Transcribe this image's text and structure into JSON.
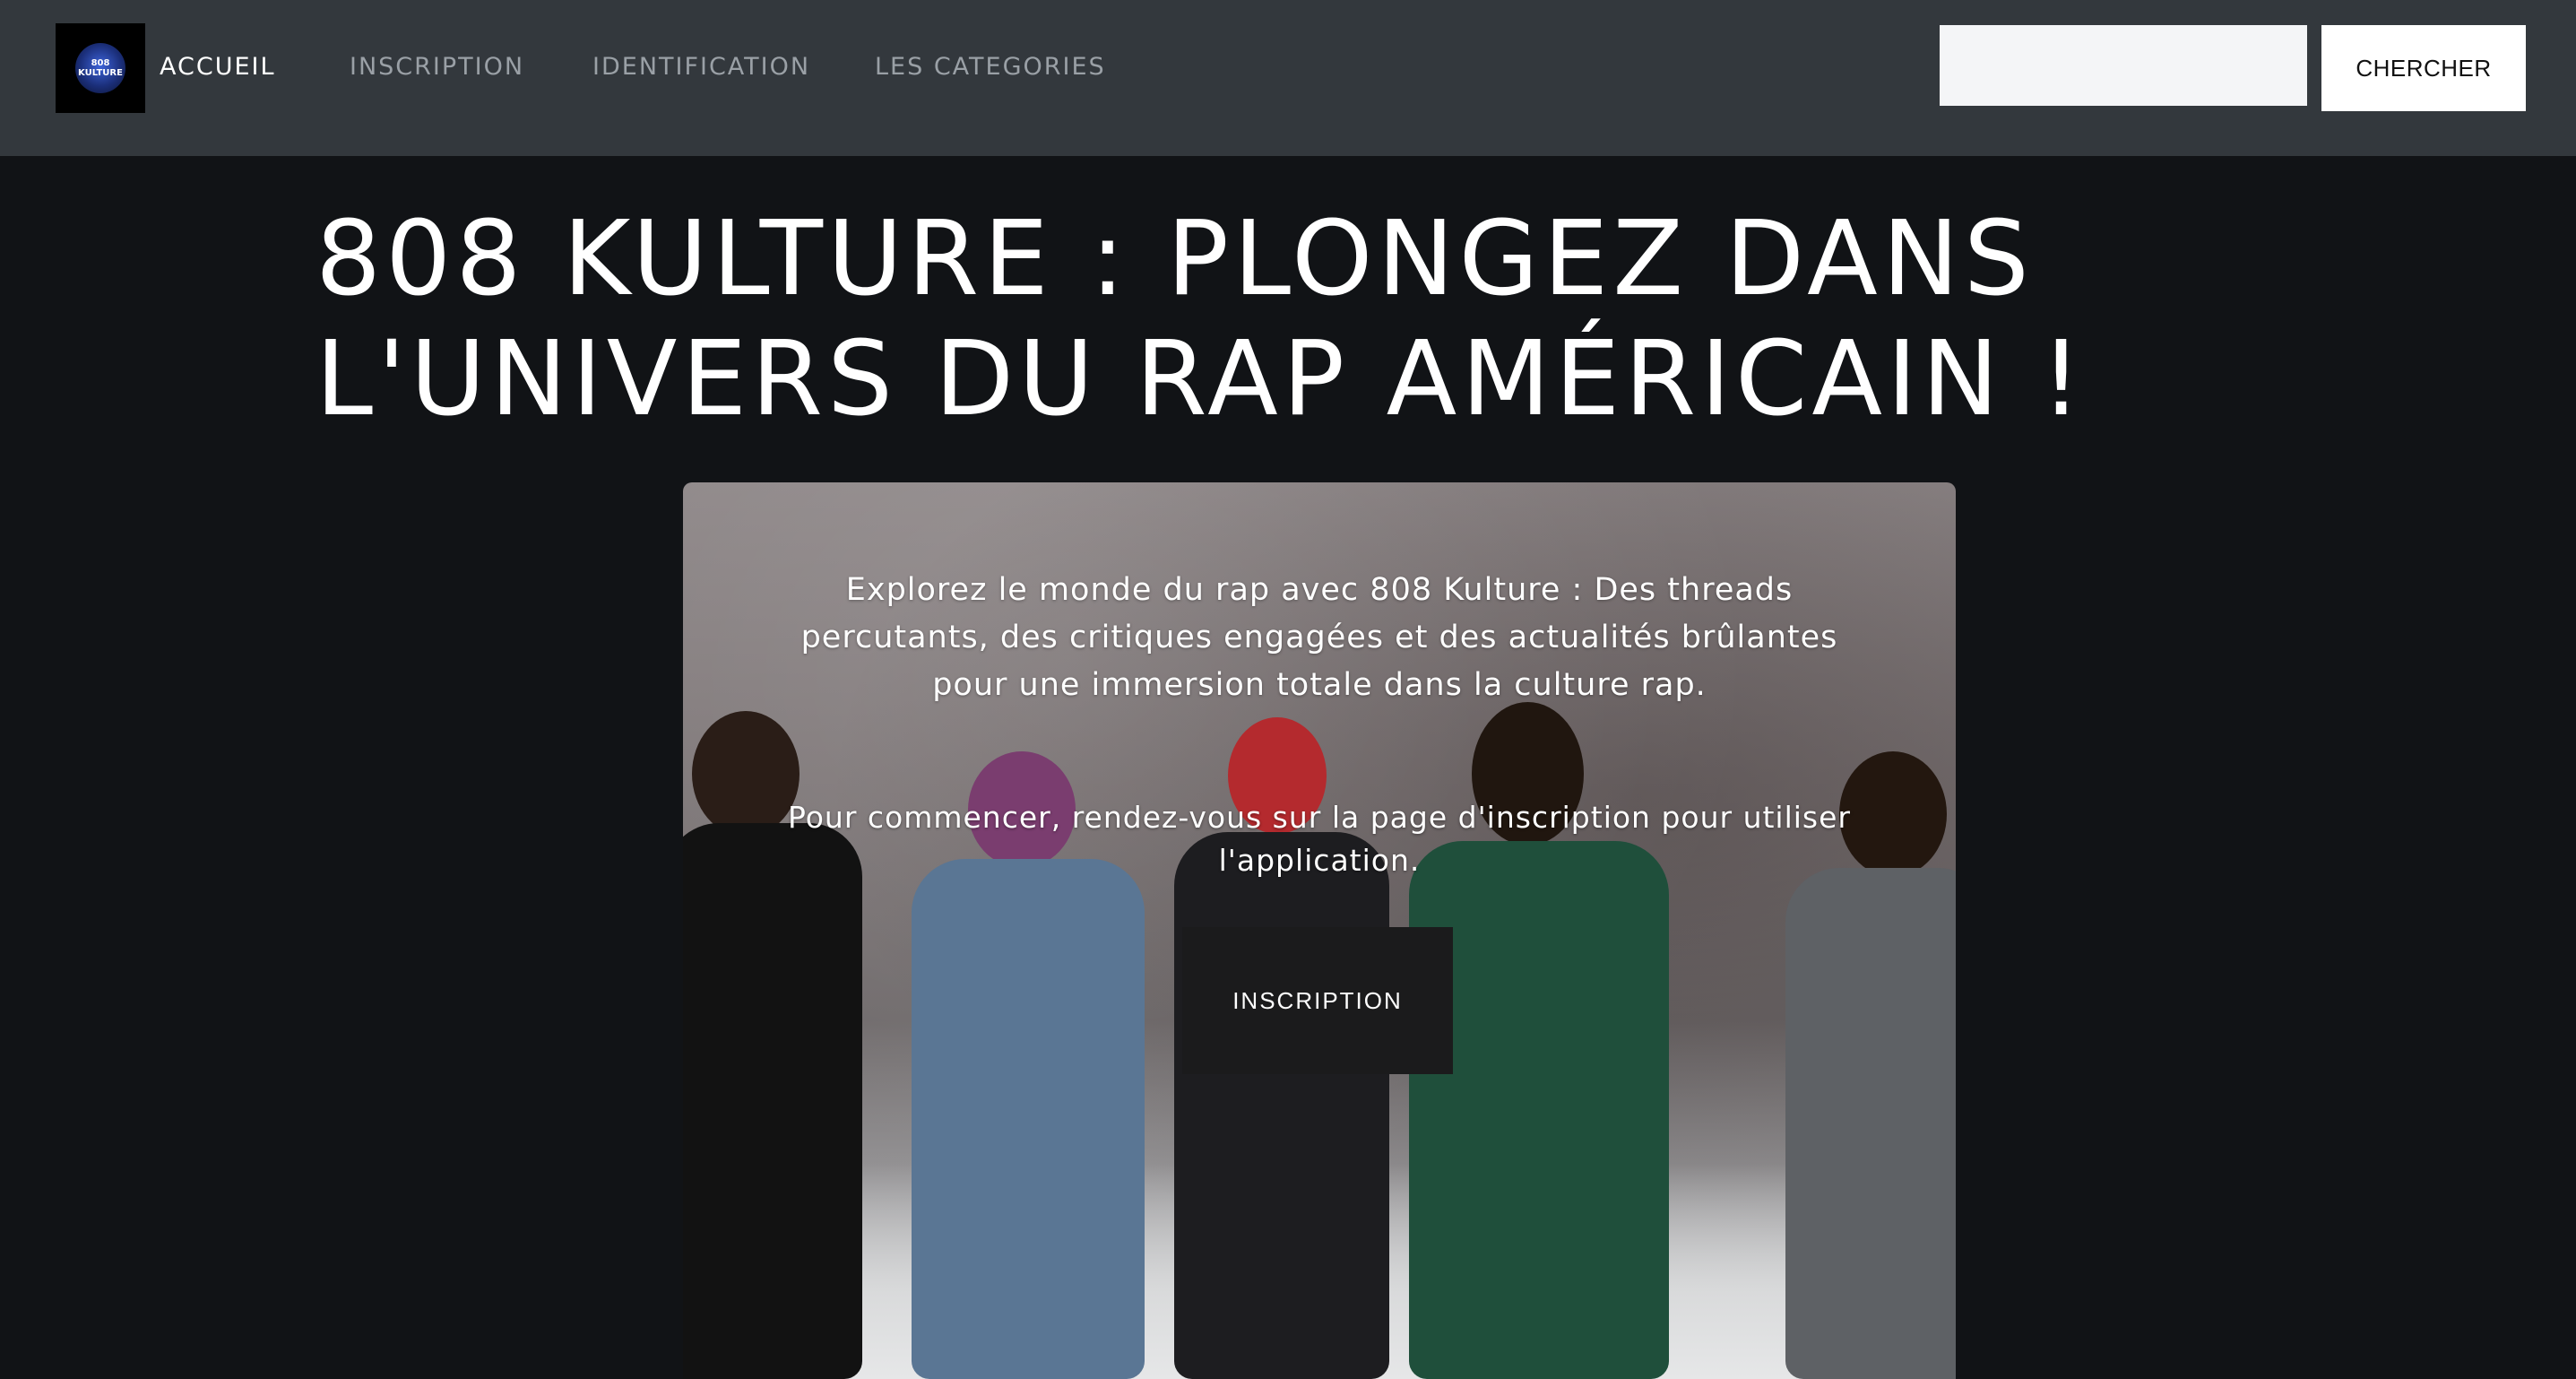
{
  "navbar": {
    "logo_text_line1": "808",
    "logo_text_line2": "KULTURE",
    "links": [
      {
        "label": "ACCUEIL"
      },
      {
        "label": "INSCRIPTION"
      },
      {
        "label": "IDENTIFICATION"
      },
      {
        "label": "LES CATEGORIES"
      }
    ],
    "search_value": "",
    "search_button_label": "CHERCHER"
  },
  "hero": {
    "title": "808 KULTURE : PLONGEZ DANS L'UNIVERS DU RAP AMÉRICAIN !"
  },
  "card": {
    "intro": "Explorez le monde du rap avec 808 Kulture : Des threads percutants, des critiques engagées et des actualités brûlantes pour une immersion totale dans la culture rap.",
    "cta_text": "Pour commencer, rendez-vous sur la page d'inscription pour utiliser l'application.",
    "button_label": "INSCRIPTION"
  },
  "colors": {
    "navbar_bg": "#33383d",
    "page_bg": "#111316",
    "active_link": "#ffffff",
    "inactive_link": "#9aa0a6"
  }
}
